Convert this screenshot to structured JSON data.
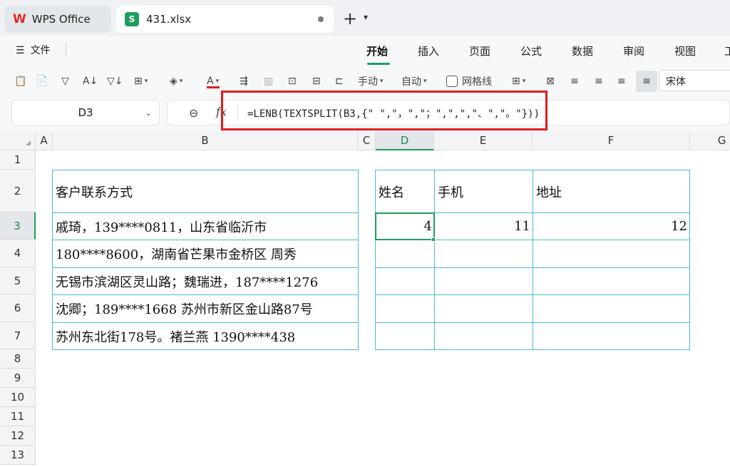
{
  "tabs": {
    "app_label": "WPS Office",
    "file_label": "431.xlsx",
    "file_icon_letter": "S"
  },
  "menubar": {
    "file_label": "文件",
    "items": [
      "开始",
      "插入",
      "页面",
      "公式",
      "数据",
      "审阅",
      "视图",
      "工"
    ],
    "active": "开始"
  },
  "toolbar": {
    "manual_label": "手动",
    "auto_label": "自动",
    "gridline_label": "网格线",
    "gridline_checked": false,
    "font_name": "宋体",
    "font_color": "#e02020"
  },
  "formula_bar": {
    "name_box": "D3",
    "fx_symbol": "fx",
    "formula": "=LENB(TEXTSPLIT(B3,{\" \",\"，\",\"；\",\",\",\"、\",\"。\"}))"
  },
  "grid": {
    "columns": [
      "A",
      "B",
      "C",
      "D",
      "E",
      "F",
      "G"
    ],
    "selected_column": "D",
    "rows": [
      "1",
      "2",
      "3",
      "4",
      "5",
      "6",
      "7",
      "8",
      "9",
      "10",
      "11",
      "12",
      "13"
    ],
    "selected_row": "3",
    "B": {
      "header": "客户联系方式",
      "values": [
        "戚琦，139****0811，山东省临沂市",
        "180****8600，湖南省芒果市金桥区 周秀",
        "无锡市滨湖区灵山路；魏瑞进，187****1276",
        "沈卿；189****1668 苏州市新区金山路87号",
        "苏州东北街178号。褚兰燕 1390****438"
      ]
    },
    "D": {
      "header": "姓名",
      "row3": "4"
    },
    "E": {
      "header": "手机",
      "row3": "11"
    },
    "F": {
      "header": "地址",
      "row3": "12"
    },
    "selected_cell": "D3"
  },
  "colors": {
    "accent_green": "#1d9f5b",
    "table_border": "#4ab9d6",
    "highlight_red": "#e01c1c"
  }
}
